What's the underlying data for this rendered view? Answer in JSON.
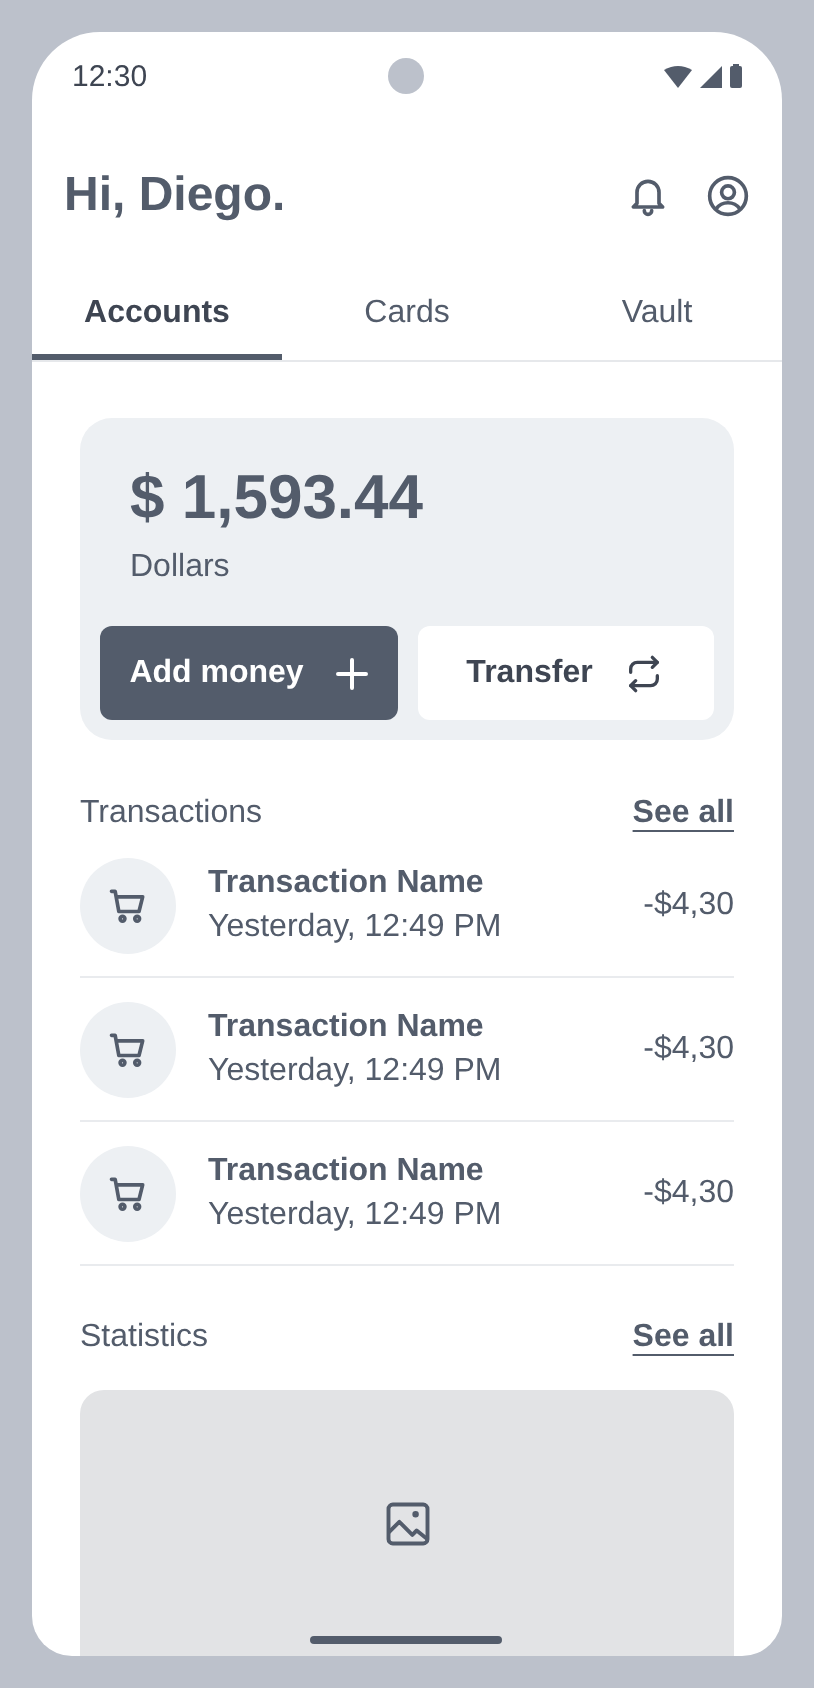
{
  "status_bar": {
    "time": "12:30"
  },
  "header": {
    "greeting": "Hi, Diego."
  },
  "tabs": [
    {
      "label": "Accounts",
      "selected": true
    },
    {
      "label": "Cards",
      "selected": false
    },
    {
      "label": "Vault",
      "selected": false
    }
  ],
  "balance": {
    "amount": "$ 1,593.44",
    "currency": "Dollars"
  },
  "actions": [
    {
      "label": "Add money",
      "kind": "add",
      "primary": true
    },
    {
      "label": "Transfer",
      "kind": "transfer",
      "primary": false
    }
  ],
  "transactions": {
    "title": "Transactions",
    "link": "See all",
    "items": [
      {
        "name": "Transaction Name",
        "time": "Yesterday, 12:49 PM",
        "amount": "-$4,30"
      },
      {
        "name": "Transaction Name",
        "time": "Yesterday, 12:49 PM",
        "amount": "-$4,30"
      },
      {
        "name": "Transaction Name",
        "time": "Yesterday, 12:49 PM",
        "amount": "-$4,30"
      }
    ]
  },
  "statistics": {
    "title": "Statistics",
    "link": "See all"
  }
}
